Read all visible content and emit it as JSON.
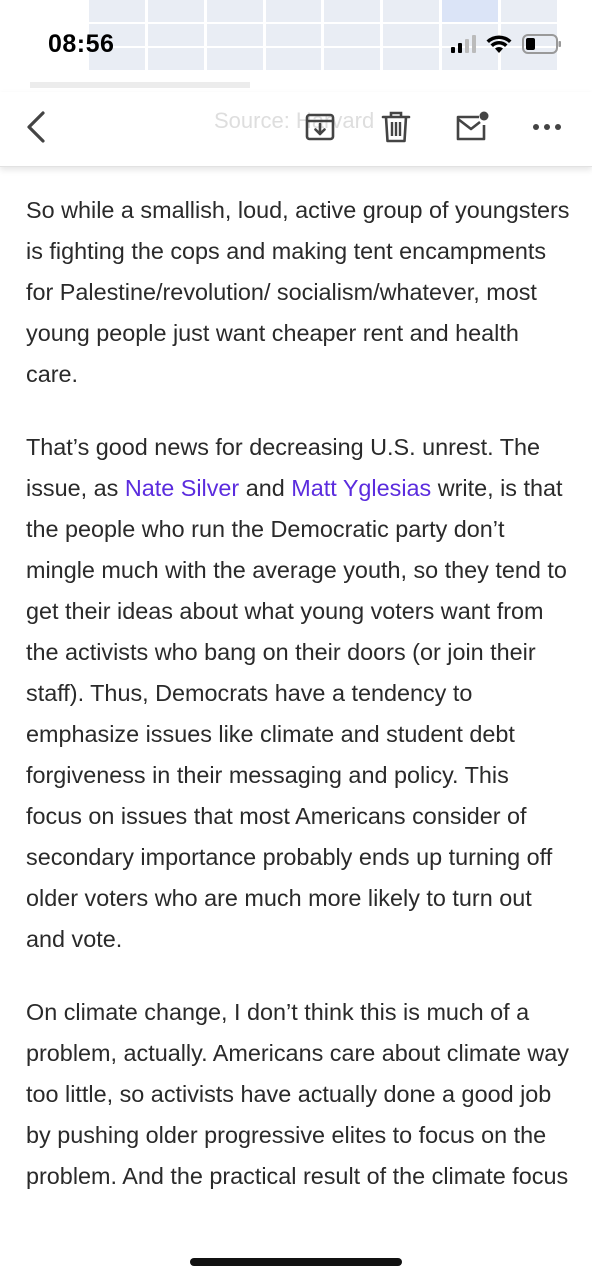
{
  "status_bar": {
    "time": "08:56"
  },
  "toolbar": {
    "ghost_text": "Source: Harvard",
    "buttons": [
      "back",
      "archive",
      "delete",
      "mark-unread",
      "more"
    ]
  },
  "article": {
    "p1": "So while a smallish, loud, active group of youngsters is fighting the cops and making tent encampments for Palestine/revolution/ socialism/whatever, most young people just want cheaper rent and health care.",
    "p2_a": "That’s good news for decreasing U.S. unrest. The issue, as ",
    "p2_link1": "Nate Silver",
    "p2_b": " and ",
    "p2_link2": "Matt Yglesias",
    "p2_c": " write, is that the people who run the Democratic party don’t mingle much with the average youth, so they tend to get their ideas about what young voters want from the activists who bang on their doors (or join their staff). Thus, Democrats have a tendency to emphasize issues like climate and student debt forgiveness in their messaging and policy. This focus on issues that most Americans consider of secondary importance probably ends up turning off older voters who are much more likely to turn out and vote.",
    "p3": "On climate change, I don’t think this is much of a problem, actually. Americans care about climate way too little, so activists have actually done a good job by pushing older progressive elites to focus on the problem. And the practical result of the climate focus"
  },
  "colors": {
    "link": "#5b2cde",
    "text": "#2a2a2a"
  }
}
